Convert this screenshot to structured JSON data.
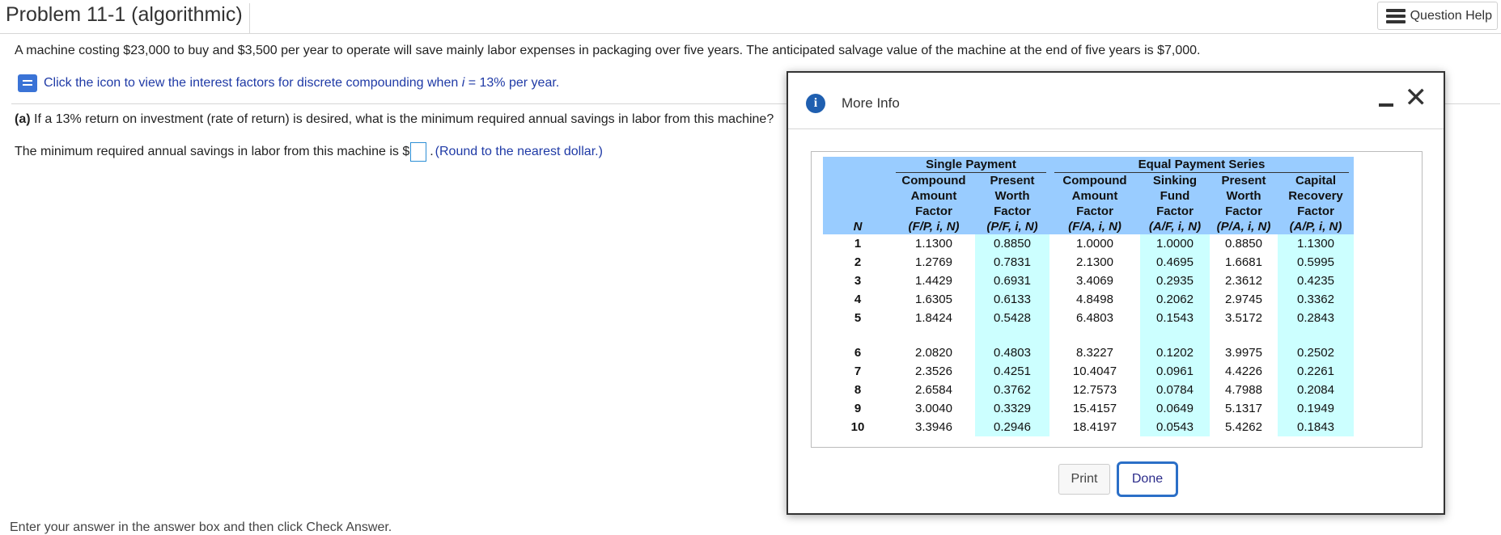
{
  "header": {
    "title": "Problem 11-1 (algorithmic)",
    "help_label": "Question Help"
  },
  "problem": {
    "statement": "A machine costing $23,000 to buy and $3,500 per year to operate will save mainly labor expenses in packaging over five years. The anticipated salvage value of the machine at the end of five years is $7,000.",
    "icon_link_text": "Click the icon to view the interest factors for discrete compounding when ",
    "icon_link_var": "i",
    "icon_link_tail": " = 13% per year.",
    "part_a_label": "(a)",
    "part_a_question": " If a 13% return on investment (rate of return) is desired, what is the minimum required annual savings in labor from this machine?",
    "answer_prefix": "The minimum required annual savings in labor from this machine is $",
    "answer_value": "",
    "answer_suffix": ".",
    "round_hint": "(Round to the nearest dollar.)",
    "footer_hint": "Enter your answer in the answer box and then click Check Answer."
  },
  "modal": {
    "title": "More Info",
    "print_label": "Print",
    "done_label": "Done",
    "table": {
      "group_single": "Single Payment",
      "group_equal": "Equal Payment Series",
      "n_label": "N",
      "columns": [
        {
          "l1": "Compound",
          "l2": "Amount",
          "l3": "Factor",
          "l4": "(F/P, i, N)"
        },
        {
          "l1": "Present",
          "l2": "Worth",
          "l3": "Factor",
          "l4": "(P/F, i, N)"
        },
        {
          "l1": "Compound",
          "l2": "Amount",
          "l3": "Factor",
          "l4": "(F/A, i, N)"
        },
        {
          "l1": "Sinking",
          "l2": "Fund",
          "l3": "Factor",
          "l4": "(A/F, i, N)"
        },
        {
          "l1": "Present",
          "l2": "Worth",
          "l3": "Factor",
          "l4": "(P/A, i, N)"
        },
        {
          "l1": "Capital",
          "l2": "Recovery",
          "l3": "Factor",
          "l4": "(A/P, i, N)"
        }
      ],
      "rows": [
        [
          "1",
          "1.1300",
          "0.8850",
          "1.0000",
          "1.0000",
          "0.8850",
          "1.1300"
        ],
        [
          "2",
          "1.2769",
          "0.7831",
          "2.1300",
          "0.4695",
          "1.6681",
          "0.5995"
        ],
        [
          "3",
          "1.4429",
          "0.6931",
          "3.4069",
          "0.2935",
          "2.3612",
          "0.4235"
        ],
        [
          "4",
          "1.6305",
          "0.6133",
          "4.8498",
          "0.2062",
          "2.9745",
          "0.3362"
        ],
        [
          "5",
          "1.8424",
          "0.5428",
          "6.4803",
          "0.1543",
          "3.5172",
          "0.2843"
        ],
        [
          "6",
          "2.0820",
          "0.4803",
          "8.3227",
          "0.1202",
          "3.9975",
          "0.2502"
        ],
        [
          "7",
          "2.3526",
          "0.4251",
          "10.4047",
          "0.0961",
          "4.4226",
          "0.2261"
        ],
        [
          "8",
          "2.6584",
          "0.3762",
          "12.7573",
          "0.0784",
          "4.7988",
          "0.2084"
        ],
        [
          "9",
          "3.0040",
          "0.3329",
          "15.4157",
          "0.0649",
          "5.1317",
          "0.1949"
        ],
        [
          "10",
          "3.3946",
          "0.2946",
          "18.4197",
          "0.0543",
          "5.4262",
          "0.1843"
        ]
      ]
    }
  },
  "colors": {
    "header_blue": "#99ccff",
    "cell_cyan": "#ccffff",
    "link_blue": "#1f3aa6",
    "done_border": "#2b6fc7"
  }
}
